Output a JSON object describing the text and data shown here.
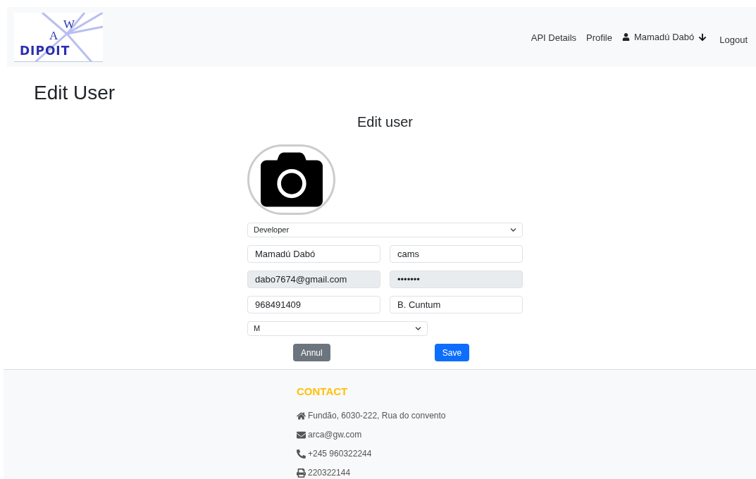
{
  "logo": {
    "letters": [
      "W",
      "A"
    ],
    "wordmark": "DIPOIT"
  },
  "nav": {
    "links": [
      "API Details",
      "Profile"
    ],
    "user": "Mamadú Dabó",
    "logout": "Logout"
  },
  "page_title": "Edit User",
  "form": {
    "title": "Edit user",
    "rows": [
      [
        {
          "kind": "select",
          "value": "Developer",
          "wide": true
        }
      ],
      [
        {
          "kind": "input",
          "value": "Mamadú Dabó",
          "disabled": false
        },
        {
          "kind": "input",
          "value": "cams",
          "disabled": false
        }
      ],
      [
        {
          "kind": "input",
          "value": "dabo7674@gmail.com",
          "disabled": true
        },
        {
          "kind": "input",
          "value": "•••••••",
          "disabled": true
        }
      ],
      [
        {
          "kind": "input",
          "value": "968491409",
          "disabled": false
        },
        {
          "kind": "input",
          "value": "B. Cuntum",
          "disabled": false
        }
      ],
      [
        {
          "kind": "select",
          "value": "M",
          "wide": false
        }
      ]
    ],
    "buttons": [
      {
        "label": "Annul",
        "kind": "secondary"
      },
      {
        "label": "Save",
        "kind": "primary"
      }
    ]
  },
  "footer": {
    "heading": "CONTACT",
    "items": [
      {
        "kind": "address",
        "text": "Fundão, 6030-222, Rua do convento"
      },
      {
        "kind": "email",
        "text": "arca@gw.com"
      },
      {
        "kind": "phone",
        "text": "+245 960322244"
      },
      {
        "kind": "fax",
        "text": "220322144"
      }
    ]
  }
}
